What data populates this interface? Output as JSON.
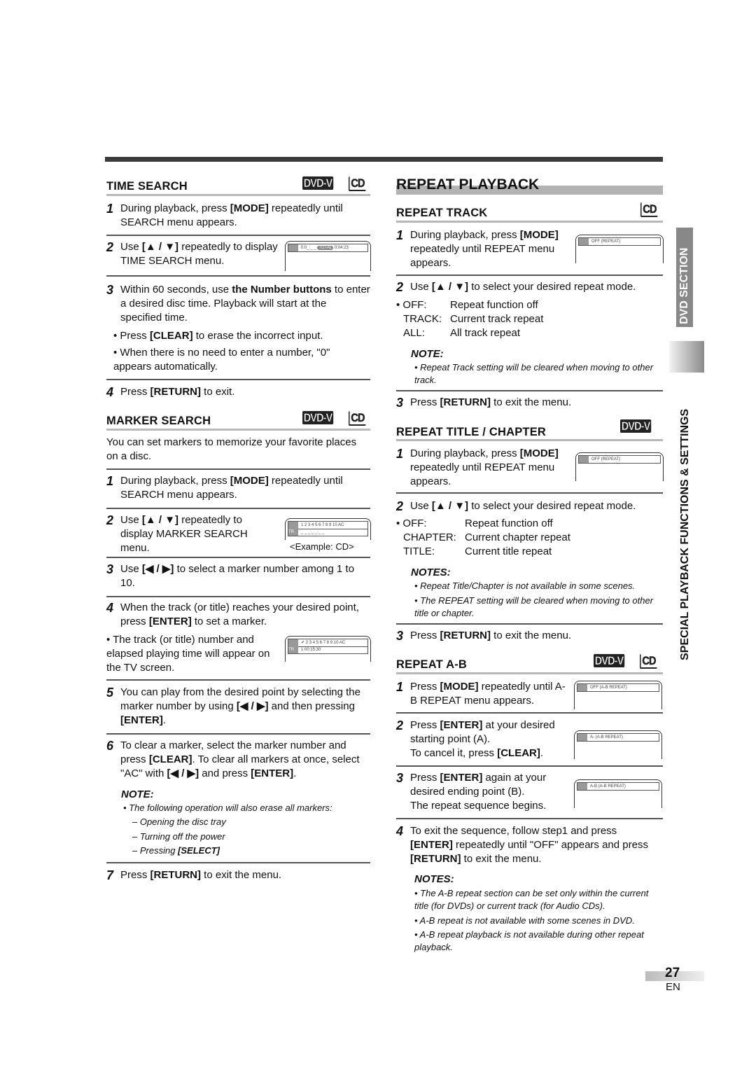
{
  "page": {
    "number": "27",
    "lang": "EN"
  },
  "side_tabs": {
    "section": "DVD SECTION",
    "chapter": "SPECIAL PLAYBACK FUNCTIONS & SETTINGS"
  },
  "badges": {
    "dvd": "DVD-V",
    "cd": "CD"
  },
  "time_search": {
    "title": "TIME SEARCH",
    "step1": {
      "n": "1",
      "text": "During playback, press [MODE] repeatedly until SEARCH menu appears."
    },
    "step2": {
      "n": "2",
      "text": "Use [▲ / ▼] repeatedly to display TIME SEARCH menu."
    },
    "screen": {
      "icon": "clock-icon",
      "value": "0:0_:_ _",
      "label": "TOTAL",
      "total": "0:04:23"
    },
    "step3": {
      "n": "3",
      "text_a": "Within 60 seconds, use ",
      "bold": "the Number buttons",
      "text_b": " to enter a desired disc time. Playback will start at the specified time."
    },
    "bullets": [
      "• Press [CLEAR] to erase the incorrect input.",
      "• When there is no need to enter a number, \"0\" appears automatically."
    ],
    "step4": {
      "n": "4",
      "text": "Press [RETURN] to exit."
    }
  },
  "marker_search": {
    "title": "MARKER SEARCH",
    "intro": "You can set markers to memorize your favorite places on a disc.",
    "step1": {
      "n": "1",
      "text": "During playback, press [MODE] repeatedly until SEARCH menu appears."
    },
    "step2": {
      "n": "2",
      "text": "Use [▲ / ▼] repeatedly to display MARKER SEARCH menu."
    },
    "screen1": {
      "markers": "1 2 3 4 5 6 7 8 9 10 AC",
      "tr": "TR",
      "value": "_ _ _:_ _:_ _",
      "caption": "<Example: CD>"
    },
    "step3": {
      "n": "3",
      "text": "Use [◀ / ▶] to select a marker number among 1 to 10."
    },
    "step4": {
      "n": "4",
      "text": "When the track (or title) reaches your desired point, press [ENTER] to set a marker."
    },
    "bullet": "• The track (or title) number and elapsed playing time will appear on the TV screen.",
    "screen2": {
      "markers": "✔ 2 3 4 5 6 7 8 9 10 AC",
      "tr": "TR",
      "value": "1  00:15:30"
    },
    "step5": {
      "n": "5",
      "text": "You can play from the desired point by selecting the marker number by using [◀ / ▶] and then pressing [ENTER]."
    },
    "step6": {
      "n": "6",
      "text": "To clear a marker, select the marker number and press [CLEAR]. To clear all markers at once, select \"AC\" with [◀ / ▶] and press [ENTER]."
    },
    "note_title": "NOTE:",
    "note": "• The following operation will also erase all markers:",
    "note_items": [
      "– Opening the disc tray",
      "– Turning off the power",
      "– Pressing [SELECT]"
    ],
    "step7": {
      "n": "7",
      "text": "Press [RETURN] to exit the menu."
    }
  },
  "repeat_playback": {
    "title": "REPEAT PLAYBACK",
    "repeat_track": {
      "title": "REPEAT TRACK",
      "step1": {
        "n": "1",
        "text": "During playback, press [MODE] repeatedly until REPEAT menu appears."
      },
      "screen": "OFF (REPEAT)",
      "step2": {
        "n": "2",
        "text": "Use [▲ / ▼] to select your desired repeat mode."
      },
      "modes": [
        {
          "key": "• OFF:",
          "desc": "Repeat function off"
        },
        {
          "key": "TRACK:",
          "desc": "Current track repeat"
        },
        {
          "key": "ALL:",
          "desc": "All track repeat"
        }
      ],
      "note_title": "NOTE:",
      "note": "• Repeat Track setting will be cleared when moving to other track.",
      "step3": {
        "n": "3",
        "text": "Press [RETURN] to exit the menu."
      }
    },
    "repeat_title": {
      "title": "REPEAT TITLE / CHAPTER",
      "step1": {
        "n": "1",
        "text": "During playback, press [MODE] repeatedly until REPEAT menu appears."
      },
      "screen": "OFF (REPEAT)",
      "step2": {
        "n": "2",
        "text": "Use [▲ / ▼] to select your desired repeat mode."
      },
      "modes": [
        {
          "key": "• OFF:",
          "desc": "Repeat function off"
        },
        {
          "key": "CHAPTER:",
          "desc": "Current chapter repeat"
        },
        {
          "key": "TITLE:",
          "desc": "Current title repeat"
        }
      ],
      "note_title": "NOTES:",
      "notes": [
        "• Repeat Title/Chapter is not available in some scenes.",
        "• The REPEAT setting will be cleared when moving to other title or chapter."
      ],
      "step3": {
        "n": "3",
        "text": "Press [RETURN] to exit the menu."
      }
    },
    "repeat_ab": {
      "title": "REPEAT A-B",
      "step1": {
        "n": "1",
        "text": "Press [MODE] repeatedly until A-B REPEAT menu appears."
      },
      "screen1": "OFF (A-B REPEAT)",
      "step2": {
        "n": "2",
        "text": "Press [ENTER] at your desired starting point (A).",
        "text2": "To cancel it, press [CLEAR]."
      },
      "screen2": "A-  (A-B REPEAT)",
      "step3": {
        "n": "3",
        "text": "Press [ENTER] again at your desired ending point (B).",
        "text2": "The repeat sequence begins."
      },
      "screen3": "A-B (A-B REPEAT)",
      "step4": {
        "n": "4",
        "text": "To exit the sequence, follow step1 and press [ENTER] repeatedly until \"OFF\" appears and press [RETURN] to exit the menu."
      },
      "note_title": "NOTES:",
      "notes": [
        "• The A-B repeat section can be set only within the current title (for DVDs) or current track (for Audio CDs).",
        "• A-B repeat is not available with some scenes in DVD.",
        "• A-B repeat playback is not available during other repeat playback."
      ]
    }
  }
}
